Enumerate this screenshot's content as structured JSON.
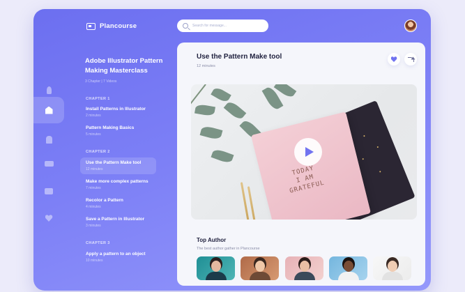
{
  "app": {
    "name": "Plancourse"
  },
  "search": {
    "placeholder": "Search for message..."
  },
  "sidebar_icons": [
    "rocket-icon",
    "home-icon",
    "building-icon",
    "bill-icon",
    "chat-icon",
    "heart-icon"
  ],
  "course": {
    "title": "Adobe Illustrator Pattern Making Masterclass",
    "meta": "3 Chapter | 7 Videos",
    "chapters": [
      {
        "label": "CHAPTER 1",
        "lessons": [
          {
            "title": "Install Patterns in Illustrator",
            "duration": "2 minutes"
          },
          {
            "title": "Pattern Making Basics",
            "duration": "5 minutes"
          }
        ]
      },
      {
        "label": "CHAPTER 2",
        "lessons": [
          {
            "title": "Use the Pattern Make tool",
            "duration": "12 minutes",
            "active": true
          },
          {
            "title": "Make more complex patterns",
            "duration": "7 minutes"
          },
          {
            "title": "Recolor a Pattern",
            "duration": "4 minutes"
          },
          {
            "title": "Save a Pattern in Illustrator",
            "duration": "3 minutes"
          }
        ]
      },
      {
        "label": "CHAPTER 3",
        "lessons": [
          {
            "title": "Apply a pattern to an object",
            "duration": "10 minutes"
          }
        ]
      }
    ]
  },
  "video": {
    "title": "Use the Pattern Make tool",
    "duration": "12 minutes",
    "notebook_text": "TODAY\nI AM\nGRATEFUL"
  },
  "authors": {
    "title": "Top Author",
    "subtitle": "The best author gather in Plancourse"
  },
  "colors": {
    "accent": "#7173f0",
    "frame": "#7c7ff6",
    "card": "#f5f6fb"
  }
}
